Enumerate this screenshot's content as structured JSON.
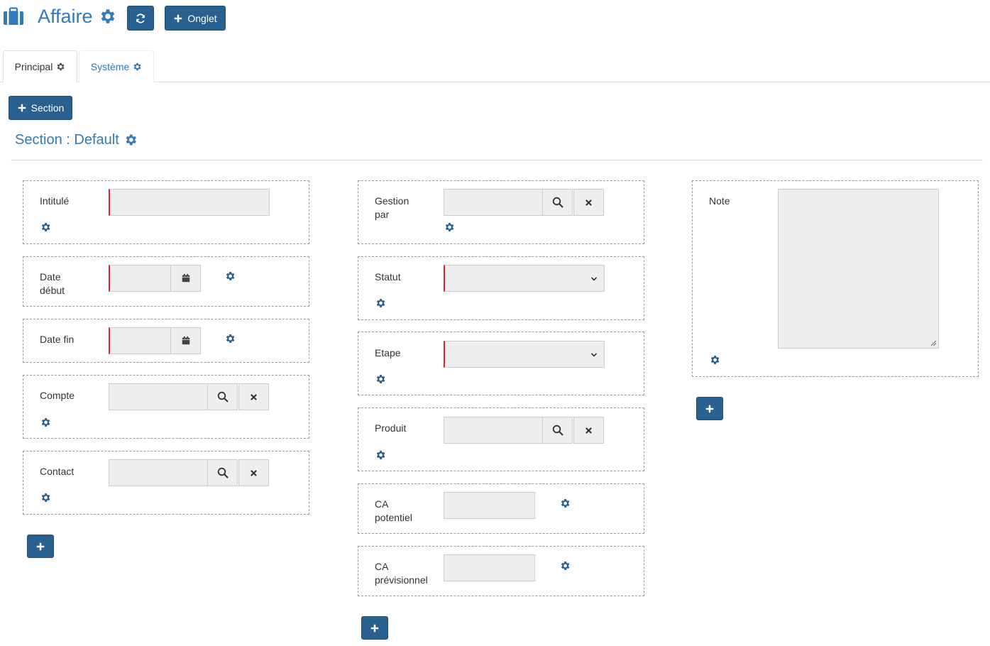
{
  "header": {
    "title": "Affaire",
    "tab_button_label": "Onglet",
    "section_button_label": "Section",
    "section_title": "Section : Default"
  },
  "tabs": [
    {
      "label": "Principal"
    },
    {
      "label": "Système"
    }
  ],
  "colors": {
    "primary": "#286090",
    "link": "#337ab7",
    "required": "#d9232d",
    "input_bg": "#eeeeee"
  },
  "fields": {
    "intitule": "Intitulé",
    "date_debut_1": "Date",
    "date_debut_2": "début",
    "date_fin": "Date fin",
    "compte": "Compte",
    "contact": "Contact",
    "gestion_1": "Gestion",
    "gestion_2": "par",
    "statut": "Statut",
    "etape": "Etape",
    "produit": "Produit",
    "ca_pot_1": "CA",
    "ca_pot_2": "potentiel",
    "ca_prev_1": "CA",
    "ca_prev_2": "prévisionnel",
    "note": "Note"
  },
  "icons": [
    "briefcase-icon",
    "gear-icon",
    "refresh-icon",
    "plus-icon",
    "search-icon",
    "clear-icon",
    "calendar-icon",
    "chevron-down-icon",
    "resize-grip-icon"
  ]
}
